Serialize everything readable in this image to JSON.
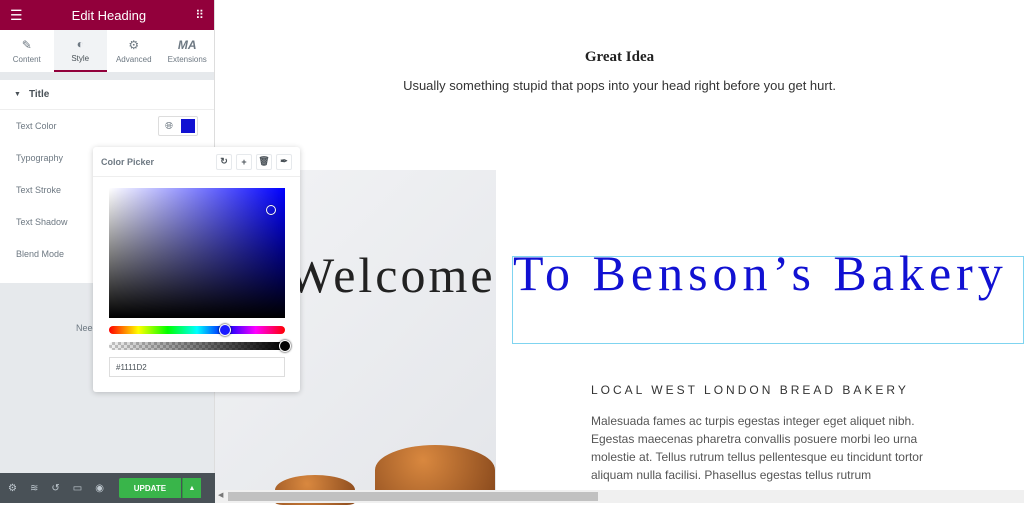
{
  "panel": {
    "title": "Edit Heading",
    "tabs": [
      {
        "label": "Content",
        "icon": "pencil-icon"
      },
      {
        "label": "Style",
        "icon": "contrast-icon",
        "active": true
      },
      {
        "label": "Advanced",
        "icon": "gear-icon"
      },
      {
        "label": "Extensions",
        "icon": "ma-logo-icon"
      }
    ],
    "section_title": "Title",
    "controls": [
      "Text Color",
      "Typography",
      "Text Stroke",
      "Text Shadow",
      "Blend Mode"
    ],
    "text_color": "#1111D2",
    "need_help": "Need",
    "update_label": "UPDATE"
  },
  "color_picker": {
    "title": "Color Picker",
    "hex_value": "#1111D2",
    "hue_percent": 66,
    "alpha_percent": 100
  },
  "canvas": {
    "heading": "Great Idea",
    "subheading": "Usually something stupid that pops into your head right before you get hurt.",
    "welcome": "Welcome",
    "benson": "To Benson’s Bakery",
    "local": "LOCAL WEST LONDON BREAD BAKERY",
    "paragraph": "Malesuada fames ac turpis egestas integer eget aliquet nibh. Egestas maecenas pharetra convallis posuere morbi leo urna molestie at. Tellus rutrum tellus pellentesque eu tincidunt tortor aliquam nulla facilisi. Phasellus egestas tellus rutrum"
  },
  "colors": {
    "brand": "#92003b",
    "update": "#39b54a",
    "heading_blue": "#1111d2"
  }
}
